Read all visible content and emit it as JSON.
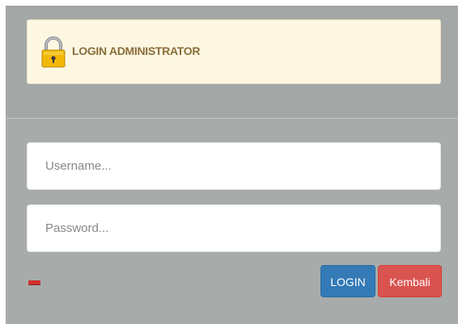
{
  "header": {
    "title": "LOGIN ADMINISTRATOR",
    "icon": "lock-icon"
  },
  "form": {
    "username": {
      "value": "",
      "placeholder": "Username..."
    },
    "password": {
      "value": "",
      "placeholder": "Password..."
    }
  },
  "buttons": {
    "login_label": "LOGIN",
    "back_label": "Kembali"
  },
  "colors": {
    "panel_bg": "#a7abaa",
    "alert_bg": "#fdf7e2",
    "alert_text": "#8a6d3b",
    "login_button": "#337ab7",
    "back_button": "#d9534f",
    "error_indicator": "#d12f2f"
  }
}
